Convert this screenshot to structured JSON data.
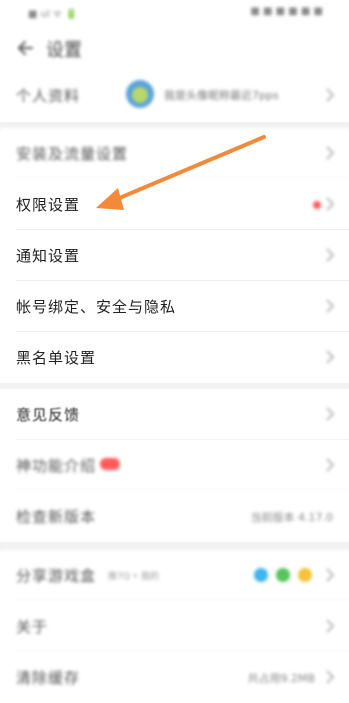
{
  "status_bar": {
    "left": "■ ul ᯤ 🔋",
    "right": "■ ■ ■ ■ ■ ■"
  },
  "header": {
    "title": "设置"
  },
  "profile": {
    "label": "个人资料",
    "name": "我是头像昵称最近7pps"
  },
  "rows": [
    {
      "label": "安装及流量设置"
    },
    {
      "label": "权限设置"
    },
    {
      "label": "通知设置"
    },
    {
      "label": "帐号绑定、安全与隐私"
    },
    {
      "label": "黑名单设置"
    },
    {
      "label": "意见反馈"
    },
    {
      "label": "神功能介绍"
    },
    {
      "label": "检查新版本",
      "value": "当前版本 4.17.0"
    },
    {
      "label": "分享游戏盒",
      "sub": "推7Q • 我的"
    },
    {
      "label": "关于"
    },
    {
      "label": "清除缓存",
      "value": "共占用9.2MB"
    }
  ],
  "colors": {
    "arrow": "#f28a3a",
    "badge": "#ff5a5a",
    "divider": "#f2f2f2"
  }
}
